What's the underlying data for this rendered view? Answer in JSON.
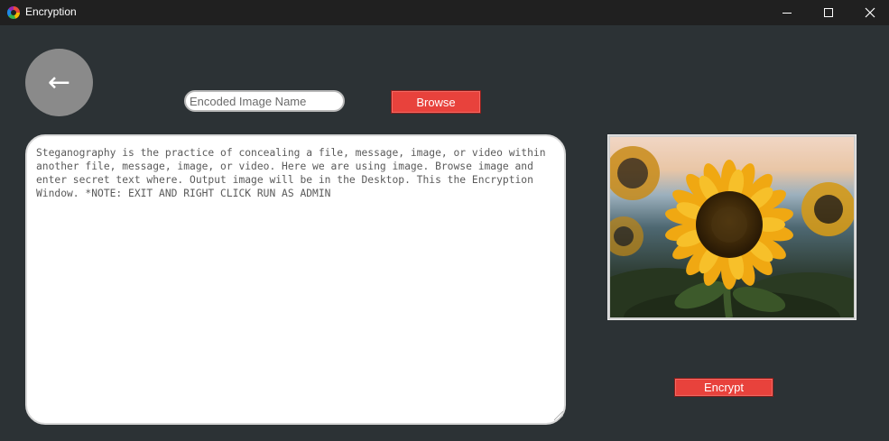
{
  "window": {
    "title": "Encryption",
    "icon": "app-color-wheel-icon",
    "controls": [
      "minimize",
      "maximize",
      "close"
    ]
  },
  "back_button": {
    "label": "←"
  },
  "encoded_name_field": {
    "value": "",
    "placeholder": "Encoded Image Name"
  },
  "browse_button": {
    "label": "Browse"
  },
  "message_area": {
    "text": "Steganography is the practice of concealing a file, message, image, or video within another file, message, image, or video. Here we are using image. Browse image and enter secret text where. Output image will be in the Desktop. This the Encryption Window. *NOTE: EXIT AND RIGHT CLICK RUN AS ADMIN"
  },
  "preview": {
    "subject": "sunflower-photo"
  },
  "encrypt_button": {
    "label": "Encrypt"
  },
  "colors": {
    "background": "#2c3235",
    "titlebar": "#202020",
    "accent_button": "#e8423c",
    "back_button": "#8a8a8a"
  }
}
